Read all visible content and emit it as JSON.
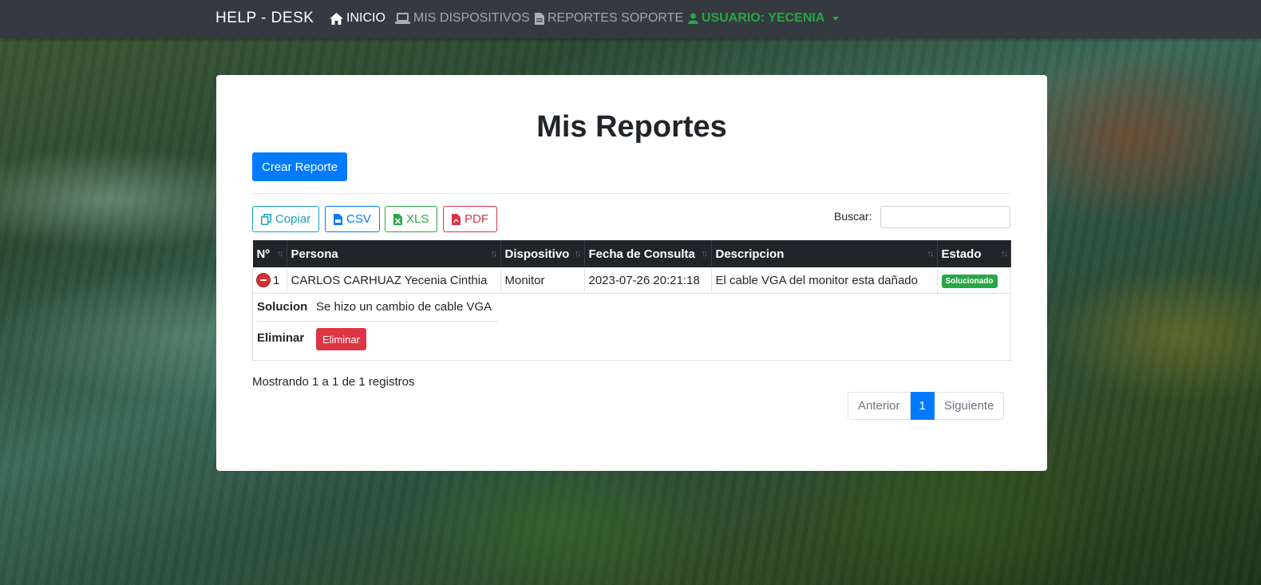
{
  "nav": {
    "brand": "HELP - DESK",
    "items": [
      {
        "label": "INICIO",
        "icon": "home-icon",
        "active": true
      },
      {
        "label": "MIS DISPOSITIVOS",
        "icon": "laptop-icon",
        "active": false
      },
      {
        "label": "REPORTES SOPORTE",
        "icon": "file-icon",
        "active": false
      }
    ],
    "user_label": "USUARIO: YECENIA",
    "user_icon": "user-icon"
  },
  "main": {
    "title": "Mis Reportes",
    "create_button": "Crear Reporte"
  },
  "export": {
    "copy": "Copiar",
    "csv": "CSV",
    "xls": "XLS",
    "pdf": "PDF"
  },
  "search": {
    "label": "Buscar:",
    "value": ""
  },
  "table": {
    "columns": [
      "Nº",
      "Persona",
      "Dispositivo",
      "Fecha de Consulta",
      "Descripcion",
      "Estado"
    ],
    "rows": [
      {
        "n": "1",
        "persona": "CARLOS CARHUAZ Yecenia Cinthia",
        "dispositivo": "Monitor",
        "fecha": "2023-07-26 20:21:18",
        "descripcion": "El cable VGA del monitor esta dañado",
        "estado": "Solucionado"
      }
    ],
    "detail": {
      "solucion_label": "Solucion",
      "solucion_value": "Se hizo un cambio de cable VGA",
      "eliminar_label": "Eliminar",
      "eliminar_button": "Eliminar"
    }
  },
  "footer": {
    "info": "Mostrando 1 a 1 de 1 registros",
    "prev": "Anterior",
    "current": "1",
    "next": "Siguiente"
  },
  "colors": {
    "navbar": "#343a40",
    "primary": "#007bff",
    "success": "#28a745",
    "danger": "#dc3545",
    "info": "#17a2b8"
  }
}
